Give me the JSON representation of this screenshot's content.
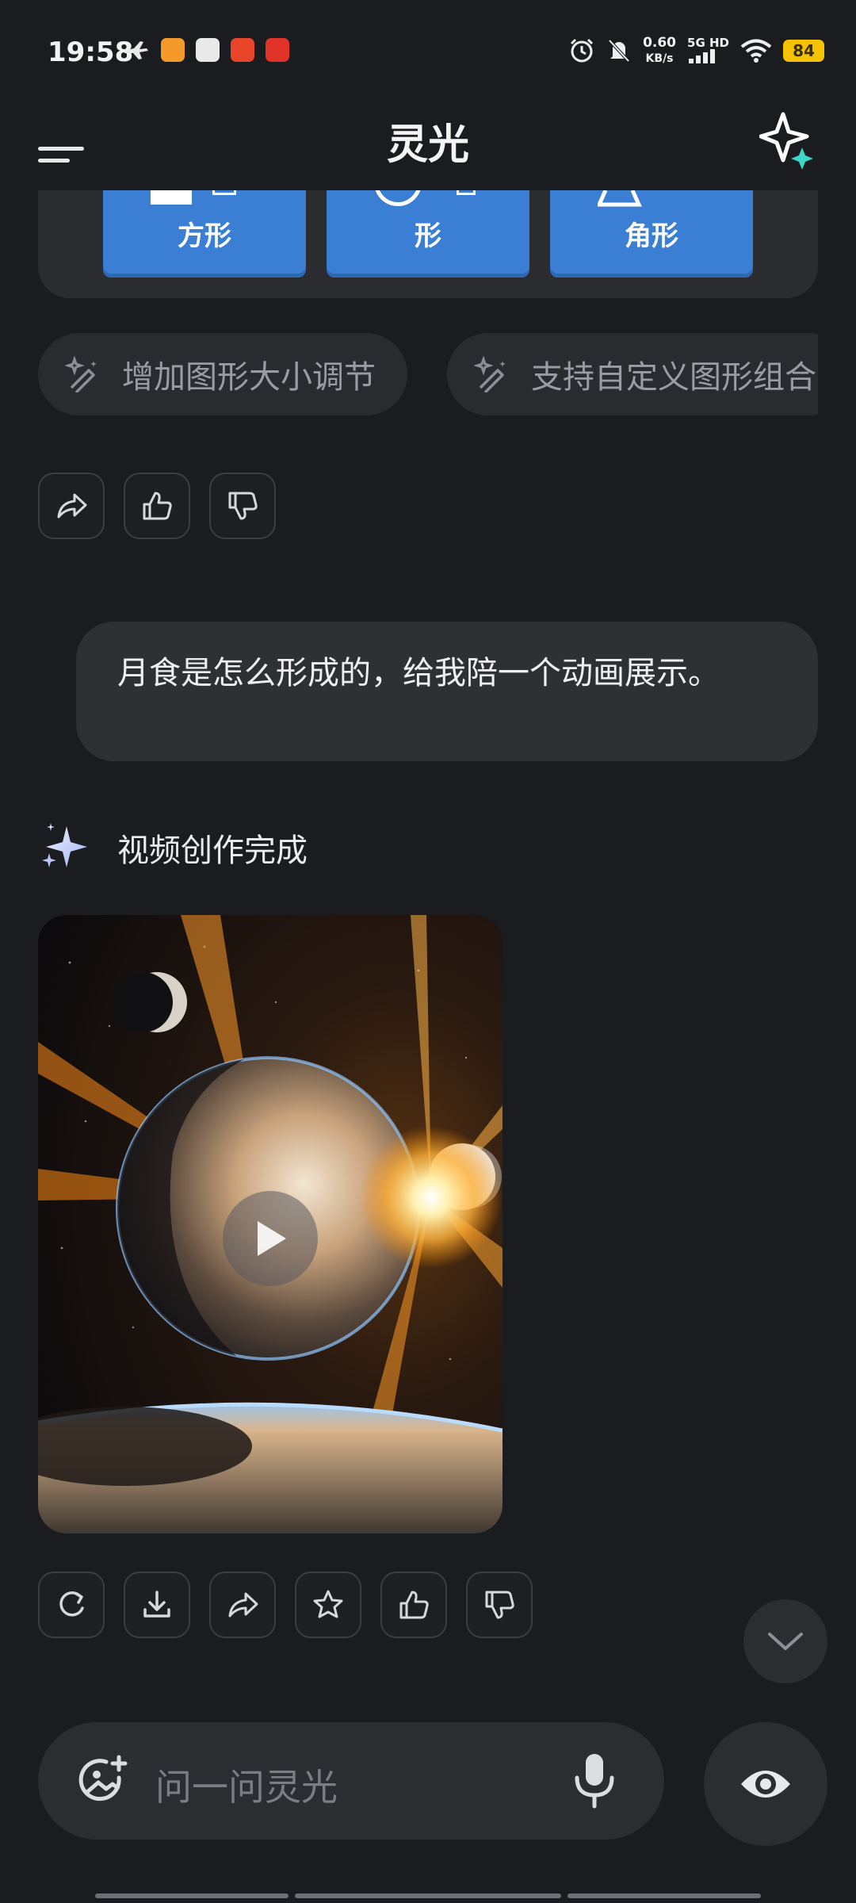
{
  "status_bar": {
    "time": "19:58",
    "net_speed": "0.60",
    "net_unit": "KB/s",
    "signal": "5G HD",
    "battery": "84"
  },
  "header": {
    "title": "灵光"
  },
  "prev_card": {
    "buttons": [
      "方形",
      "形",
      "角形"
    ]
  },
  "suggestions": [
    "增加图形大小调节",
    "支持自定义图形组合"
  ],
  "user_message": "月食是怎么形成的，给我陪一个动画展示。",
  "assistant": {
    "status": "视频创作完成"
  },
  "input": {
    "placeholder": "问一问灵光"
  },
  "colors": {
    "background": "#1b1c1f",
    "accent_blue": "#3b7fd4",
    "battery": "#f5c200"
  }
}
